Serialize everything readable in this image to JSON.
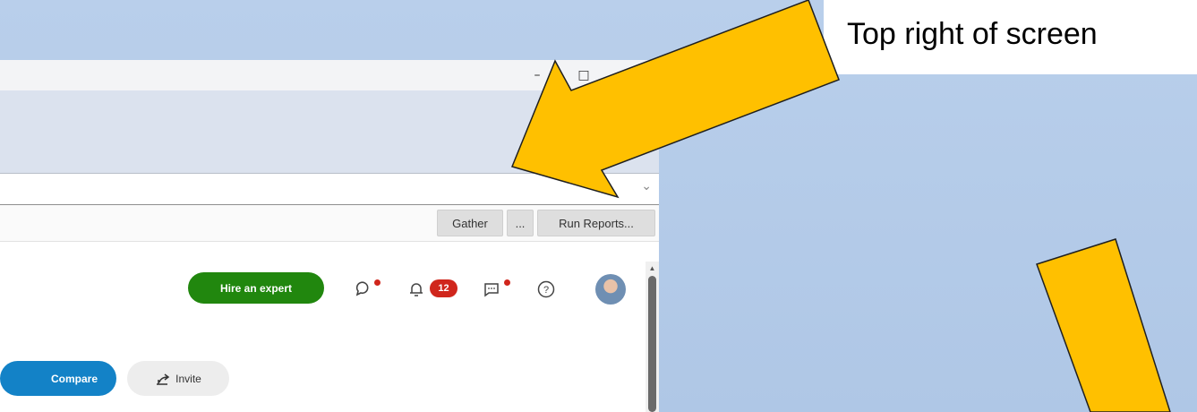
{
  "browser": {
    "window_controls": {
      "minimize": "–",
      "maximize": "□",
      "close": "×"
    },
    "address_bar": {
      "value": "",
      "dropdown_icon": "chevron-down-icon"
    },
    "bookmarks": [
      {
        "label": "Gather"
      },
      {
        "label": "..."
      },
      {
        "label": "Run Reports..."
      }
    ]
  },
  "page_header": {
    "hire_button": "Hire an expert",
    "notification_count": "12",
    "icons": [
      "lightbulb-icon",
      "bell-icon",
      "message-icon",
      "help-icon"
    ]
  },
  "actions": {
    "compare_label": "Compare",
    "invite_label": "Invite",
    "invite_icon": "share-icon"
  },
  "callout": {
    "text": "Top right of screen"
  },
  "colors": {
    "arrow_fill": "#FFC000",
    "arrow_outline": "#1F1F1F",
    "slide_background": "#B4CBE9",
    "hire_green": "#21870E",
    "compare_blue": "#1382C7",
    "badge_red": "#D0261C"
  }
}
